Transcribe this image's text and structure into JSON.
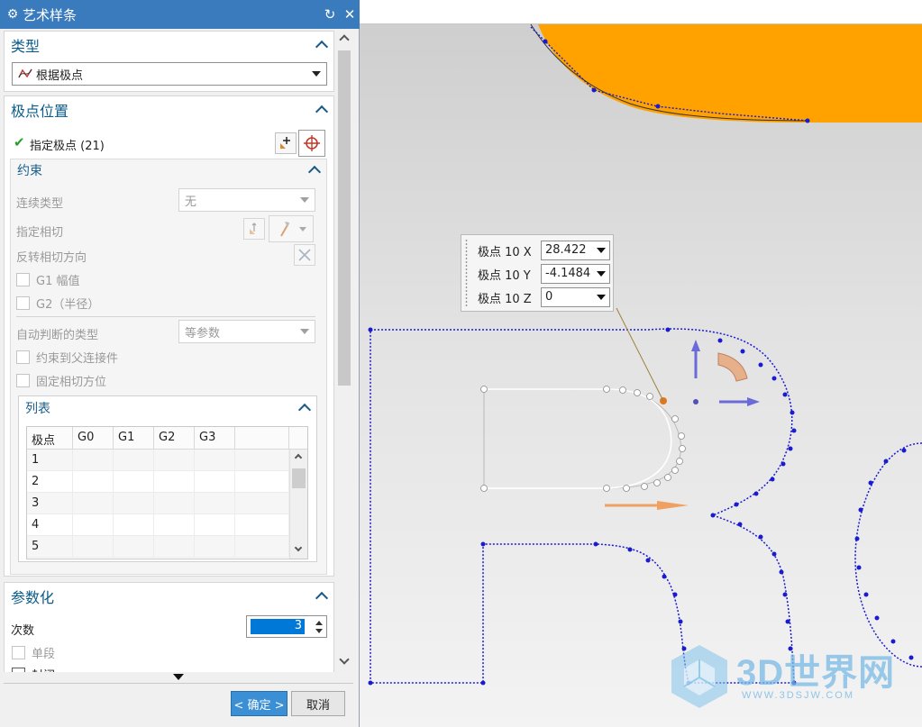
{
  "dialog": {
    "title": "艺术样条",
    "type_section": {
      "label": "类型",
      "value": "根据极点"
    },
    "pole_section": {
      "label": "极点位置",
      "specify_pole": "指定极点 (21)"
    },
    "constraint_section": {
      "label": "约束",
      "continuity_label": "连续类型",
      "continuity_value": "无",
      "tangent_label": "指定相切",
      "reverse_label": "反转相切方向",
      "g1_label": "G1 幅值",
      "g2_label": "G2（半径）",
      "inferred_label": "自动判断的类型",
      "inferred_value": "等参数",
      "constrain_parent_label": "约束到父连接件",
      "fix_tangent_label": "固定相切方位"
    },
    "list_section": {
      "label": "列表",
      "columns": [
        "极点",
        "G0",
        "G1",
        "G2",
        "G3",
        ""
      ],
      "rows": [
        "1",
        "2",
        "3",
        "4",
        "5"
      ]
    },
    "param_section": {
      "label": "参数化",
      "degree_label": "次数",
      "degree_value": "3",
      "single_segment_label": "单段",
      "partial_label": "封闭"
    },
    "ok_label": "< 确定 >",
    "cancel_label": "取消"
  },
  "viewport": {
    "coords": [
      {
        "label": "极点 10 X",
        "value": "28.422"
      },
      {
        "label": "极点 10 Y",
        "value": "-4.1484"
      },
      {
        "label": "极点 10 Z",
        "value": "0"
      }
    ],
    "watermark_main": "3D世界网",
    "watermark_url": "WWW.3DSJW.COM"
  },
  "colors": {
    "title_bar": "#3a7bbd",
    "section_text": "#0c5c8a",
    "curve": "#1a1ad0",
    "orange_fill": "#ffa200"
  }
}
